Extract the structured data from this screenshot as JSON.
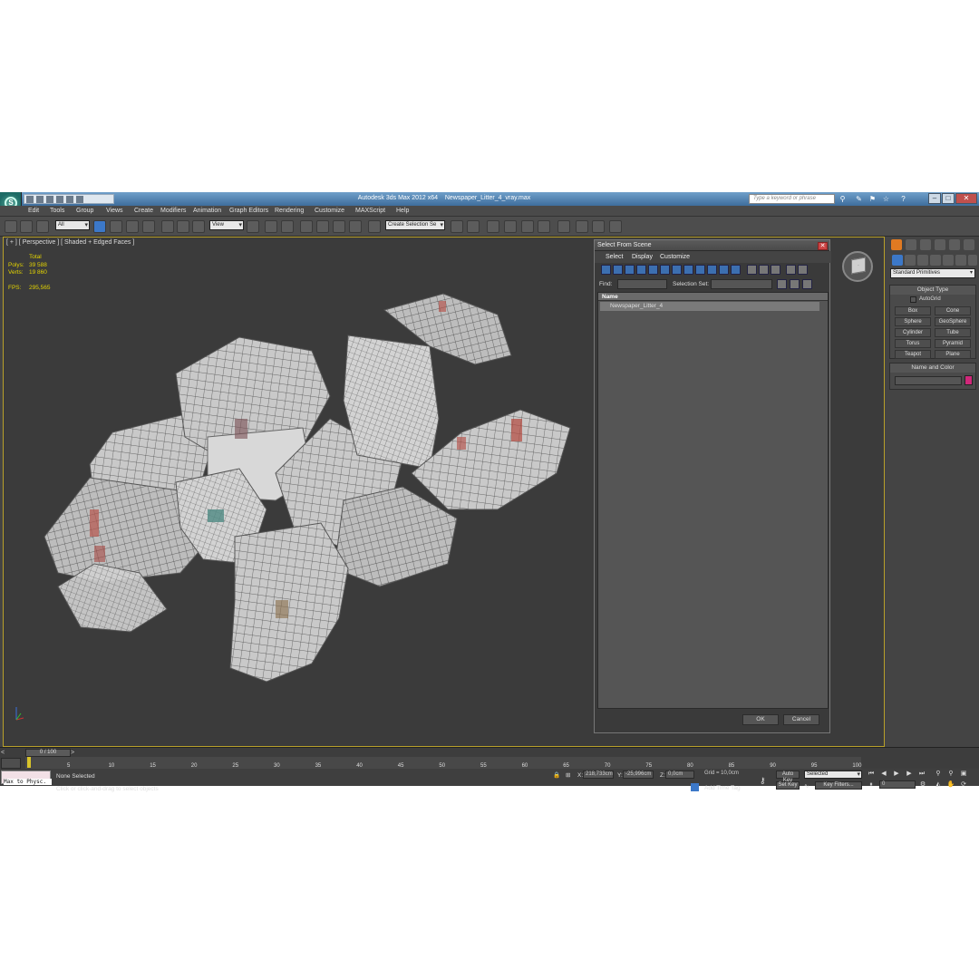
{
  "window": {
    "app_title": "Autodesk 3ds Max  2012 x64",
    "file_title": "Newspaper_Litter_4_vray.max",
    "search_placeholder": "Type a keyword or phrase"
  },
  "menu": [
    "Edit",
    "Tools",
    "Group",
    "Views",
    "Create",
    "Modifiers",
    "Animation",
    "Graph Editors",
    "Rendering",
    "Customize",
    "MAXScript",
    "Help"
  ],
  "toolbar": {
    "selection_filter": "All",
    "reference_coord": "View",
    "named_selection": "Create Selection Se"
  },
  "viewport": {
    "label": "[ + ] [ Perspective ] [ Shaded + Edged Faces ]",
    "stats": {
      "total_label": "Total",
      "polys_label": "Polys:",
      "polys": "39 588",
      "verts_label": "Verts:",
      "verts": "19 860",
      "fps_label": "FPS:",
      "fps": "295,565"
    }
  },
  "dialog": {
    "title": "Select From Scene",
    "menu": [
      "Select",
      "Display",
      "Customize"
    ],
    "find_label": "Find:",
    "selection_set_label": "Selection Set:",
    "column_name": "Name",
    "items": [
      "Newspaper_Litter_4"
    ],
    "ok": "OK",
    "cancel": "Cancel"
  },
  "command_panel": {
    "category": "Standard Primitives",
    "object_type_header": "Object Type",
    "autogrid": "AutoGrid",
    "objects": [
      "Box",
      "Cone",
      "Sphere",
      "GeoSphere",
      "Cylinder",
      "Tube",
      "Torus",
      "Pyramid",
      "Teapot",
      "Plane"
    ],
    "name_color_header": "Name and Color",
    "object_color": "#d0287a"
  },
  "timeline": {
    "slider": "0 / 100",
    "ticks": [
      "5",
      "10",
      "15",
      "20",
      "25",
      "30",
      "35",
      "40",
      "45",
      "50",
      "55",
      "60",
      "65",
      "70",
      "75",
      "80",
      "85",
      "90",
      "95",
      "100"
    ]
  },
  "status": {
    "maxscript": "Max to Physc.",
    "selection": "None Selected",
    "prompt": "Click or click-and-drag to select objects",
    "x_label": "X:",
    "x": "218,733cm",
    "y_label": "Y:",
    "y": "-25,996cm",
    "z_label": "Z:",
    "z": "0,0cm",
    "grid": "Grid = 10,0cm",
    "add_time_tag": "Add Time Tag",
    "auto_key": "Auto Key",
    "set_key": "Set Key",
    "key_mode": "Selected",
    "key_filters": "Key Filters...",
    "frame": "0"
  }
}
